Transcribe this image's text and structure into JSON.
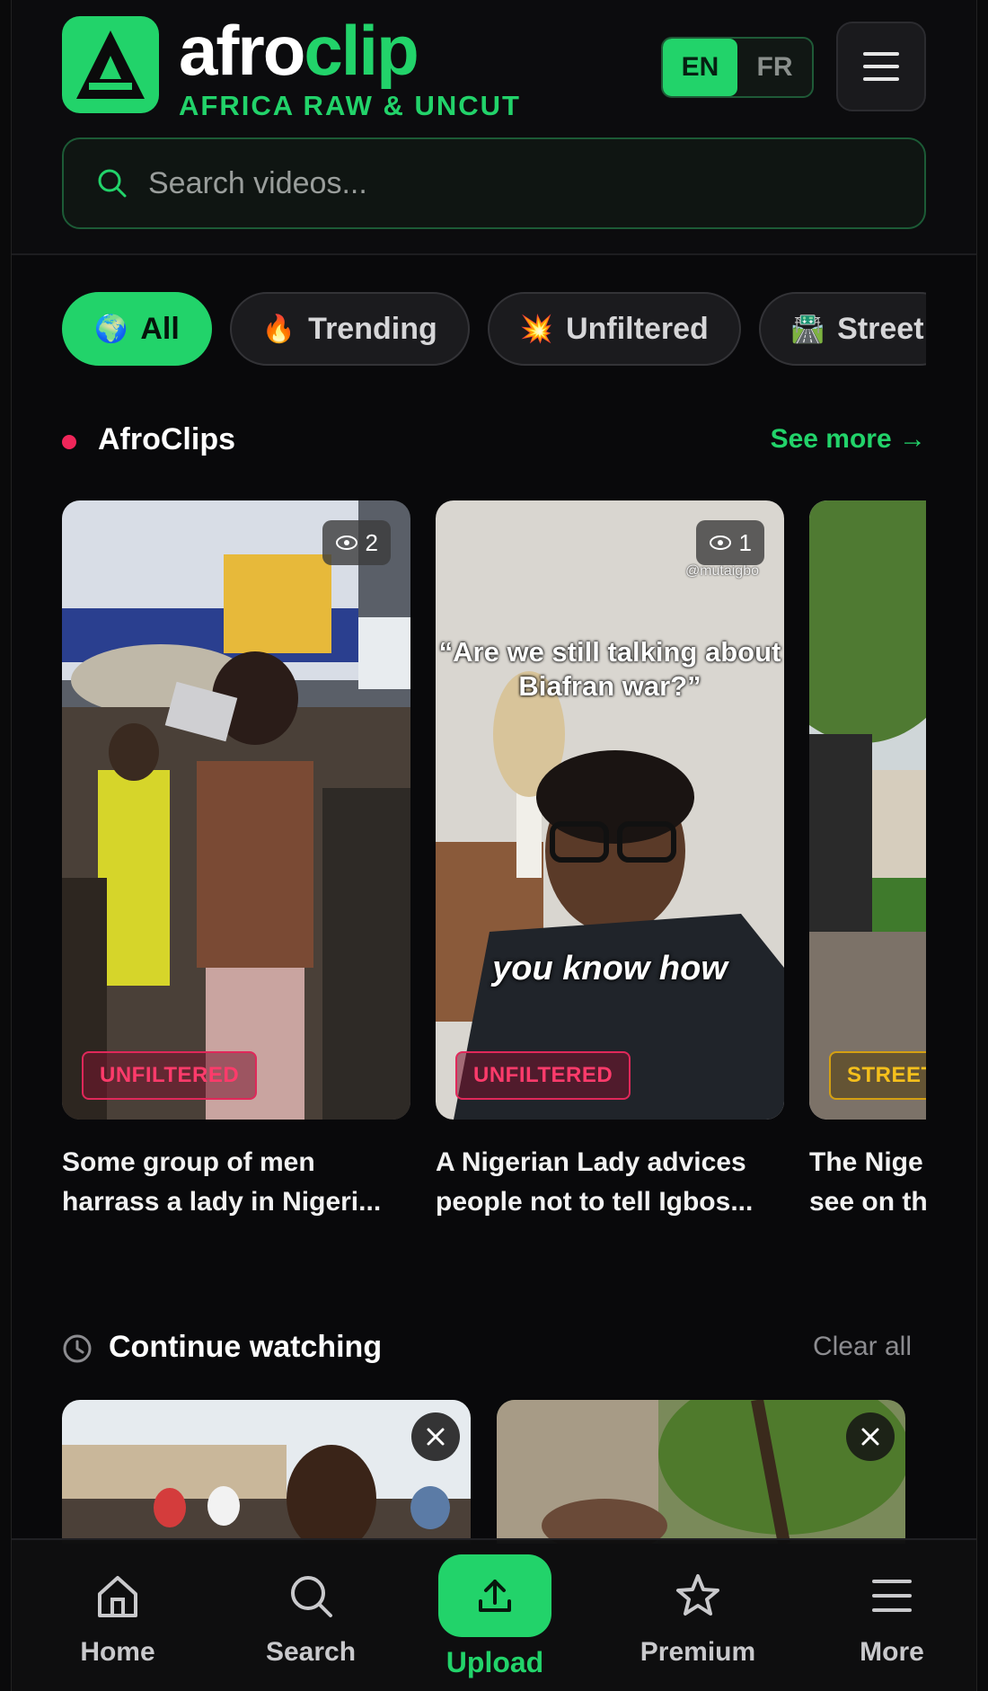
{
  "brand": {
    "name_part1": "afro",
    "name_part2": "clip",
    "tagline": "AFRICA RAW & UNCUT",
    "accent_color": "#22d36a"
  },
  "language": {
    "options": [
      "EN",
      "FR"
    ],
    "selected": "EN"
  },
  "search": {
    "placeholder": "Search videos..."
  },
  "categories": [
    {
      "label": "All",
      "icon": "globe-emoji",
      "glyph": "🌍",
      "active": true
    },
    {
      "label": "Trending",
      "icon": "fire-emoji",
      "glyph": "🔥",
      "active": false
    },
    {
      "label": "Unfiltered",
      "icon": "collision-emoji",
      "glyph": "💥",
      "active": false
    },
    {
      "label": "Street",
      "icon": "road-emoji",
      "glyph": "🛣️",
      "active": false
    }
  ],
  "afroclips": {
    "title": "AfroClips",
    "see_more": "See more →",
    "cards": [
      {
        "views": "2",
        "badge": "UNFILTERED",
        "title": "Some group of men harrass a lady in Nigeri..."
      },
      {
        "views": "1",
        "badge": "UNFILTERED",
        "title": "A Nigerian Lady advices people not to tell Igbos...",
        "overlay_handle": "@mutaigbo",
        "overlay_quote_line1": "“Are we still talking about",
        "overlay_quote_line2": "Biafran war?”",
        "overlay_caption": "you know how"
      },
      {
        "badge": "STREET",
        "title_line1": "The Nige",
        "title_line2": "see on th"
      }
    ]
  },
  "continue_watching": {
    "title": "Continue watching",
    "clear_all": "Clear all"
  },
  "bottom_nav": {
    "home": "Home",
    "search": "Search",
    "upload": "Upload",
    "premium": "Premium",
    "more": "More"
  },
  "colors": {
    "unfiltered": "#ff3b6b",
    "street": "#f5c01c",
    "live_dot": "#f0265a"
  }
}
